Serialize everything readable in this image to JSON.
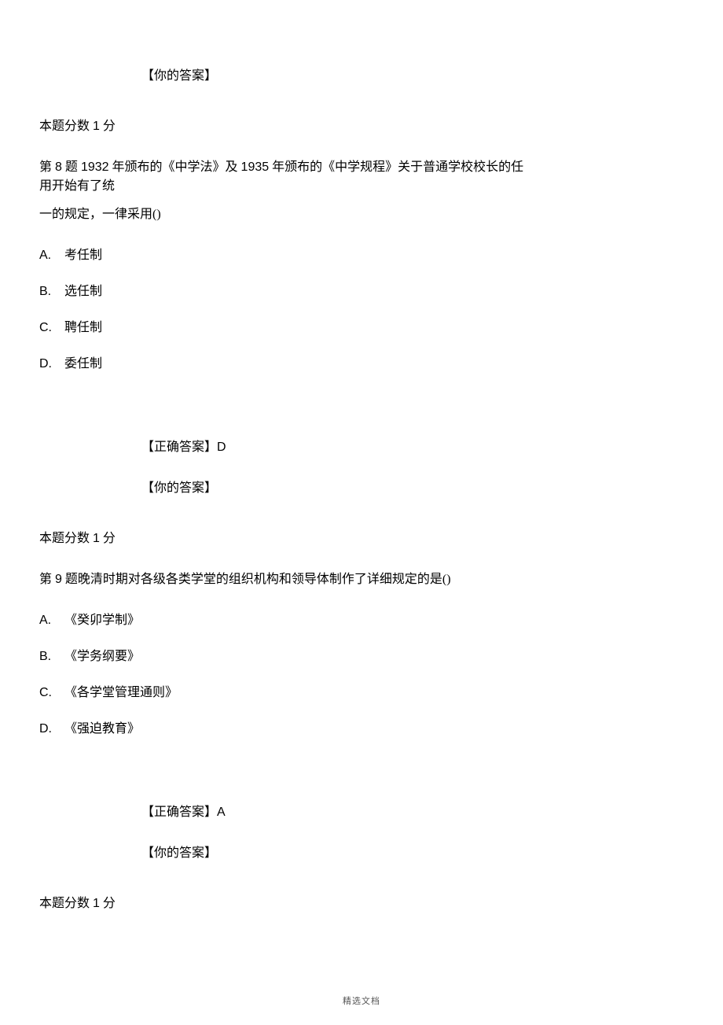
{
  "top": {
    "your_answer_label": "【你的答案】",
    "score_line_pre": "本题分数 ",
    "score_value": "1",
    "score_line_post": " 分"
  },
  "q8": {
    "stem_line1_pre": "第 ",
    "stem_num": "8",
    "stem_line1_mid": " 题 ",
    "stem_year1": "1932",
    "stem_text1": " 年颁布的《中学法》及 ",
    "stem_year2": "1935",
    "stem_text2": " 年颁布的《中学规程》关于普通学校校长的任用开始有了统",
    "stem_line2": "一的规定，一律采用()",
    "opts": {
      "A": "考任制",
      "B": "选任制",
      "C": "聘任制",
      "D": "委任制"
    },
    "correct_label": "【正确答案】",
    "correct_value": "D",
    "your_answer_label": "【你的答案】",
    "score_pre": "本题分数 ",
    "score_value": "1",
    "score_post": " 分"
  },
  "q9": {
    "stem_pre": "第 ",
    "stem_num": "9",
    "stem_text": " 题晚清时期对各级各类学堂的组织机构和领导体制作了详细规定的是()",
    "opts": {
      "A": "《癸卯学制》",
      "B": "《学务纲要》",
      "C": "《各学堂管理通则》",
      "D": "《强迫教育》"
    },
    "correct_label": "【正确答案】",
    "correct_value": "A",
    "your_answer_label": "【你的答案】",
    "score_pre": "本题分数 ",
    "score_value": "1",
    "score_post": " 分"
  },
  "footer": "精选文档"
}
